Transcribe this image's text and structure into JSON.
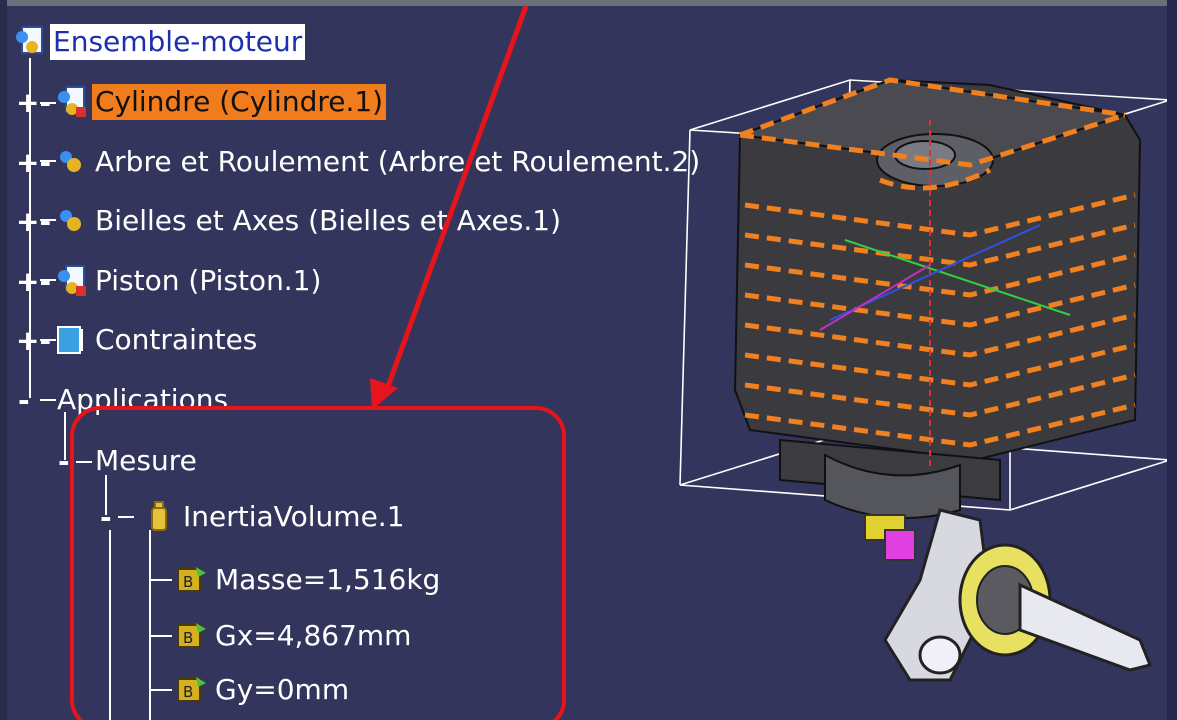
{
  "tree": {
    "root": {
      "label": "Ensemble-moteur",
      "icon": "product-icon"
    },
    "children": [
      {
        "label": "Cylindre (Cylindre.1)",
        "icon": "part-icon",
        "expander": "+",
        "selected": true
      },
      {
        "label": "Arbre et Roulement (Arbre et Roulement.2)",
        "icon": "component-icon",
        "expander": "+"
      },
      {
        "label": "Bielles et Axes (Bielles et Axes.1)",
        "icon": "component-icon",
        "expander": "+"
      },
      {
        "label": "Piston (Piston.1)",
        "icon": "part-icon",
        "expander": "+"
      },
      {
        "label": "Contraintes",
        "icon": "constraints-icon",
        "expander": "+"
      },
      {
        "label": "Applications",
        "expander": "-"
      }
    ],
    "mesure": {
      "label": "Mesure",
      "expander": "-"
    },
    "inertia": {
      "label": "InertiaVolume.1",
      "icon": "measure-icon",
      "expander": "-"
    },
    "params": [
      {
        "label": "Masse=1,516kg",
        "icon": "parameter-icon"
      },
      {
        "label": "Gx=4,867mm",
        "icon": "parameter-icon"
      },
      {
        "label": "Gy=0mm",
        "icon": "parameter-icon"
      }
    ]
  },
  "annotation": {
    "arrow_color": "#e8141c",
    "box_color": "#e8141c"
  },
  "colors": {
    "background": "#33355c",
    "selection_orange": "#f07c1e",
    "selection_blue": "#1b2fb0",
    "highlight_dash": "#f08020"
  }
}
